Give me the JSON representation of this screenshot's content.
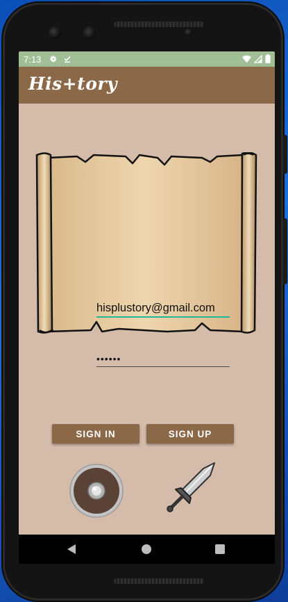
{
  "status_bar": {
    "time": "7:13",
    "left_icons": [
      "settings-icon",
      "download-done-icon"
    ],
    "right_icons": [
      "wifi-icon",
      "cell-signal-icon",
      "battery-icon"
    ],
    "color": "#a1bf97"
  },
  "app_bar": {
    "title": "His+tory",
    "color": "#8b6847"
  },
  "login_form": {
    "email_value": "hisplustory@gmail.com",
    "password_value": "••••••",
    "email_underline_color": "#1fb89c"
  },
  "buttons": {
    "sign_in_label": "SIGN IN",
    "sign_up_label": "SIGN UP"
  },
  "illustrations": [
    "parchment-scroll-image",
    "shield-icon",
    "sword-icon"
  ],
  "nav_bar": {
    "items": [
      "back-icon",
      "home-icon",
      "recents-icon"
    ]
  },
  "theme": {
    "background": "#d5bbaa",
    "accent": "#8b6847"
  }
}
